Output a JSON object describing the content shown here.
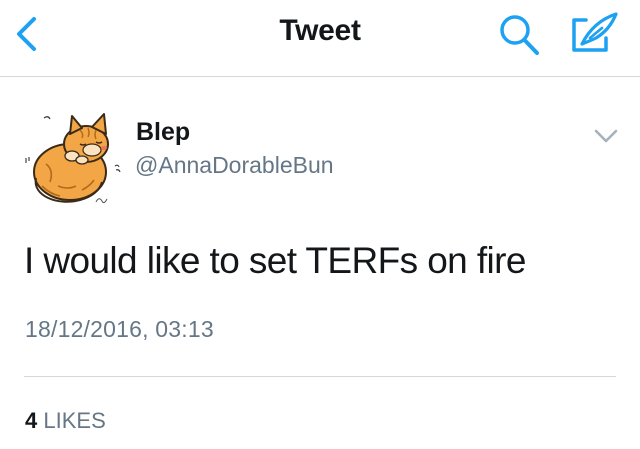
{
  "navbar": {
    "title": "Tweet",
    "back_icon": "chevron-left-icon",
    "search_icon": "search-icon",
    "compose_icon": "compose-tweet-icon",
    "accent_color": "#1da1f2"
  },
  "tweet": {
    "display_name": "Blep",
    "username": "@AnnaDorableBun",
    "avatar_icon": "cat-illustration-avatar",
    "menu_icon": "chevron-down-icon",
    "text": "I would like to set TERFs on fire",
    "timestamp": "18/12/2016, 03:13",
    "likes_count": "4",
    "likes_label": "LIKES"
  },
  "colors": {
    "text_primary": "#14171a",
    "text_secondary": "#657786",
    "divider": "#d5d8dc",
    "accent": "#1da1f2"
  }
}
